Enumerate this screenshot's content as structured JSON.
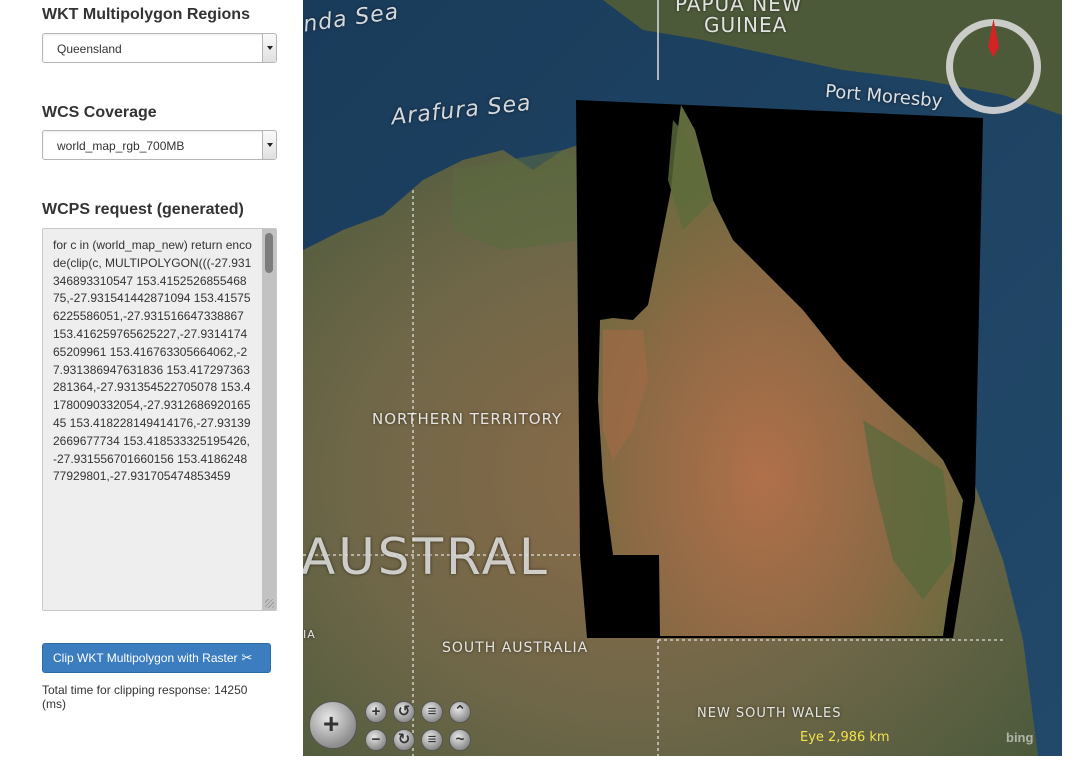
{
  "panel": {
    "region_title": "WKT Multipolygon Regions",
    "region_value": "Queensland",
    "coverage_title": "WCS Coverage",
    "coverage_value": "world_map_rgb_700MB",
    "wcps_title": "WCPS request (generated)",
    "wcps_text": "for c in (world_map_new) return encode(clip(c, MULTIPOLYGON(((-27.931346893310547 153.415252685546875,-27.931541442871094 153.415756225586051,-27.931516647338867 153.416259765625227,-27.931417465209961 153.416763305664062,-27.931386947631836 153.417297363281364,-27.931354522705078 153.41780090332054,-27.931268692016545 153.418228149414176,-27.931392669677734 153.418533325195426,-27.931556701660156 153.418624877929801,-27.931705474853459",
    "clip_button_label": "Clip WKT Multipolygon with Raster",
    "clip_button_icon": "scissors-icon",
    "timing_text": "Total time for clipping response: 14250 (ms)"
  },
  "map": {
    "labels": {
      "banda_sea": "nda Sea",
      "png": "PAPUA NEW",
      "guinea": "GUINEA",
      "arafura": "Arafura Sea",
      "port_moresby": "Port Moresby",
      "nt": "NORTHERN TERRITORY",
      "australia": "AUSTRAL",
      "sa": "SOUTH AUSTRALIA",
      "nsw": "NEW SOUTH WALES",
      "wa": "IA"
    },
    "eye": "Eye  2,986 km",
    "bing": "bing"
  },
  "colors": {
    "button_blue": "#3b7dbf",
    "eye_text": "#f1e24a",
    "compass_needle": "#d42323"
  }
}
